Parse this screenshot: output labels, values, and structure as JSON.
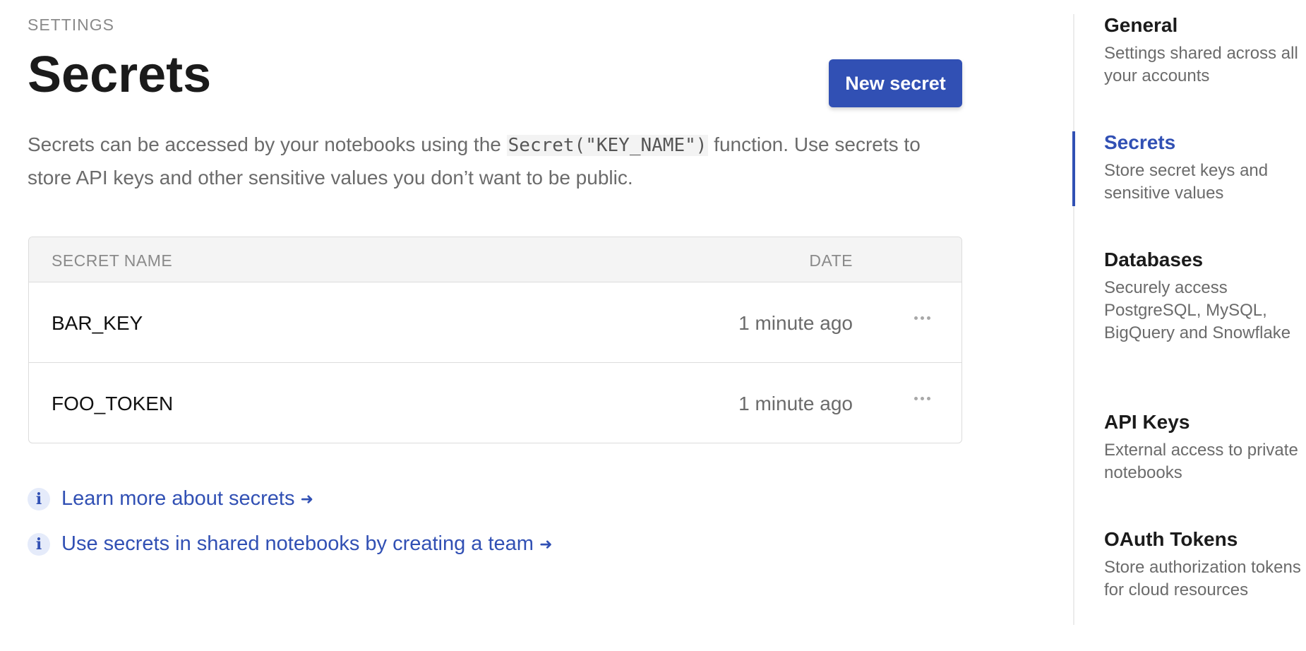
{
  "header": {
    "eyebrow": "SETTINGS",
    "title": "Secrets",
    "new_button_label": "New secret"
  },
  "intro": {
    "before": "Secrets can be accessed by your notebooks using the ",
    "code": "Secret(\"KEY_NAME\")",
    "after": " function. Use secrets to store API keys and other sensitive values you don’t want to be public."
  },
  "table": {
    "columns": [
      "SECRET NAME",
      "DATE"
    ],
    "rows": [
      {
        "name": "BAR_KEY",
        "date": "1 minute ago"
      },
      {
        "name": "FOO_TOKEN",
        "date": "1 minute ago"
      }
    ]
  },
  "links": [
    {
      "text": "Learn more about secrets",
      "arrow": "➜"
    },
    {
      "text": "Use secrets in shared notebooks by creating a team",
      "arrow": "➜"
    }
  ],
  "sidebar": {
    "items": [
      {
        "title": "General",
        "description": "Settings shared across all your accounts",
        "active": false
      },
      {
        "title": "Secrets",
        "description": "Store secret keys and sensitive values",
        "active": true
      },
      {
        "title": "Databases",
        "description": "Securely access PostgreSQL, MySQL, BigQuery and Snowflake",
        "active": false
      },
      {
        "title": "API Keys",
        "description": "External access to private notebooks",
        "active": false
      },
      {
        "title": "OAuth Tokens",
        "description": "Store authorization tokens for cloud resources",
        "active": false
      }
    ]
  },
  "colors": {
    "accent": "#3150b4",
    "muted_text": "#6b6b6b",
    "header_bg": "#f4f4f4"
  },
  "icons": {
    "info": "i",
    "more": "more-horizontal-icon"
  }
}
